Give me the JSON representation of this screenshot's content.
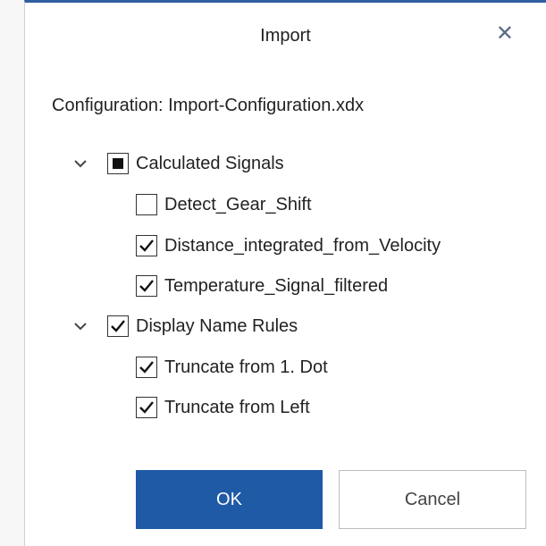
{
  "dialog": {
    "title": "Import",
    "close_glyph": "✕",
    "configuration_label": "Configuration: Import-Configuration.xdx"
  },
  "tree": {
    "calculated_signals": {
      "label": "Calculated Signals",
      "state": "indeterminate",
      "expanded": true,
      "children": [
        {
          "label": "Detect_Gear_Shift",
          "checked": false
        },
        {
          "label": "Distance_integrated_from_Velocity",
          "checked": true
        },
        {
          "label": "Temperature_Signal_filtered",
          "checked": true
        }
      ]
    },
    "display_name_rules": {
      "label": "Display Name Rules",
      "state": "checked",
      "expanded": true,
      "children": [
        {
          "label": "Truncate from 1. Dot",
          "checked": true
        },
        {
          "label": "Truncate from Left",
          "checked": true
        }
      ]
    }
  },
  "buttons": {
    "ok_label": "OK",
    "cancel_label": "Cancel"
  },
  "colors": {
    "accent": "#1f5aa6",
    "title_bar_border": "#2f5f9e",
    "close_icon": "#5a6b86"
  },
  "icons": {
    "close": "close-icon",
    "expand": "chevron-down-icon",
    "checkmark": "checkmark-icon"
  }
}
